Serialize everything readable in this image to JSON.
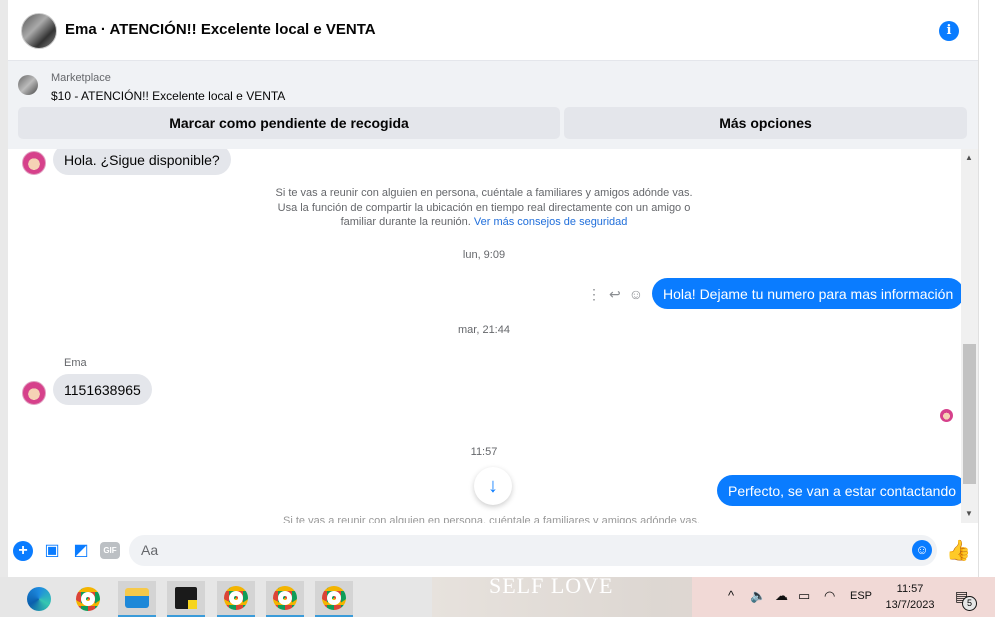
{
  "header": {
    "title": "Ema · ATENCIÓN!! Excelente local e VENTA",
    "info_icon": "info-icon"
  },
  "marketplace": {
    "label": "Marketplace",
    "listing_title": "$10 - ATENCIÓN!! Excelente local e VENTA",
    "button_pending": "Marcar como pendiente de recogida",
    "button_more": "Más opciones"
  },
  "messages": {
    "m1": "Hola. ¿Sigue disponible?",
    "safety_text": "Si te vas a reunir con alguien en persona, cuéntale a familiares y amigos adónde vas. Usa la función de compartir la ubicación en tiempo real directamente con un amigo o familiar durante la reunión.",
    "safety_link": "Ver más consejos de seguridad",
    "ts1": "lun, 9:09",
    "m2": "Hola! Dejame tu numero para mas información",
    "ts2": "mar, 21:44",
    "sender_name": "Ema",
    "m3": "1151638965",
    "ts3": "11:57",
    "m4": "Perfecto, se van a estar contactando",
    "faded": "Si te vas a reunir con alguien en persona, cuéntale a familiares y amigos adónde vas."
  },
  "composer": {
    "placeholder": "Aa",
    "icons": [
      "plus-icon",
      "photo-icon",
      "sticker-icon",
      "gif-icon",
      "emoji-icon",
      "like-icon"
    ],
    "gif_label": "GIF"
  },
  "taskbar": {
    "background_text": "SELF LOVE",
    "language": "ESP",
    "time": "11:57",
    "date": "13/7/2023",
    "notification_count": "5"
  },
  "colors": {
    "accent": "#0a7cff",
    "incoming_bubble": "#e4e6eb"
  }
}
